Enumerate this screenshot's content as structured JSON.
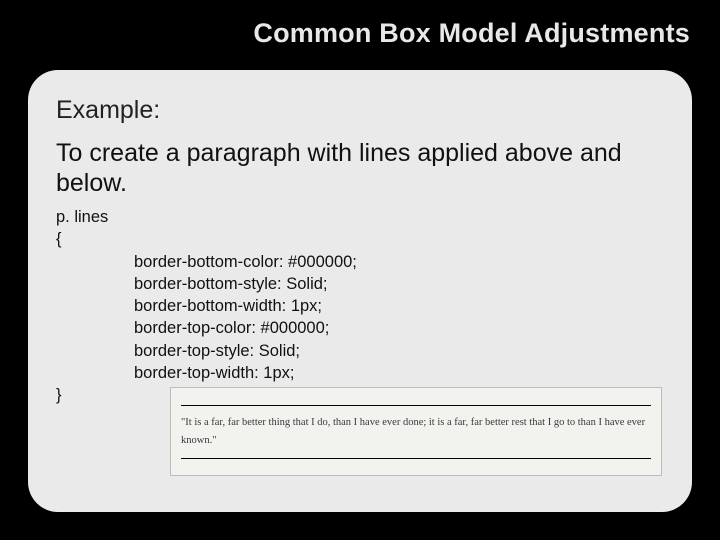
{
  "title": "Common Box Model Adjustments",
  "example_label": "Example:",
  "example_desc": "To create a paragraph with lines applied above and below.",
  "code": {
    "selector": "p. lines",
    "open": "{",
    "lines": [
      "border-bottom-color: #000000;",
      "border-bottom-style: Solid;",
      "border-bottom-width: 1px;",
      "border-top-color: #000000;",
      "border-top-style: Solid;",
      "border-top-width: 1px;"
    ],
    "close": "}"
  },
  "rendered_quote": "\"It is a far, far better thing that I do, than I have ever done; it is a far, far better rest that I go to than I have ever known.\""
}
